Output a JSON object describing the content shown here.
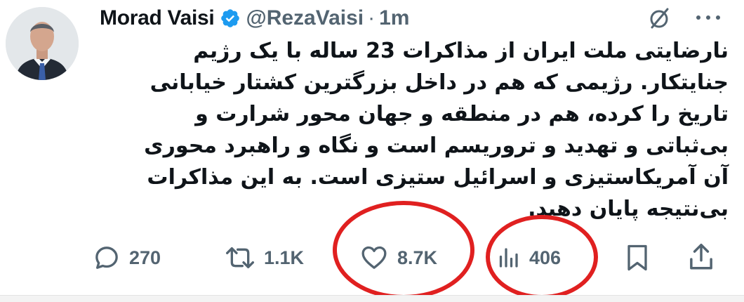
{
  "tweet": {
    "author_name": "Morad Vaisi",
    "handle": "@RezaVaisi",
    "separator": "·",
    "time": "1m",
    "text_lines": [
      "نارضایتی ملت ایران از مذاکرات 23 ساله با یک رژیم",
      "جنایتکار. رژیمی که هم در داخل بزرگترین کشتار خیابانی",
      "تاریخ را کرده، هم در منطقه و جهان محور شرارت و",
      "بی‌ثباتی و تهدید و تروریسم است و نگاه و راهبرد محوری",
      "آن آمریکاستیزی و اسرائیل ستیزی است. به این مذاکرات",
      "بی‌نتیجه پایان دهید."
    ]
  },
  "actions": {
    "replies": "270",
    "reposts": "1.1K",
    "likes": "8.7K",
    "views": "406"
  },
  "icons": {
    "verified": "verified-badge-icon",
    "grok": "grok-icon",
    "more": "more-icon",
    "reply": "reply-icon",
    "repost": "repost-icon",
    "like": "heart-icon",
    "views": "views-icon",
    "bookmark": "bookmark-icon",
    "share": "share-icon"
  },
  "colors": {
    "text": "#0f1419",
    "muted": "#536471",
    "verified": "#1d9bf0",
    "annotation": "#e02020"
  },
  "annotations": {
    "circled": [
      "likes",
      "views"
    ]
  }
}
